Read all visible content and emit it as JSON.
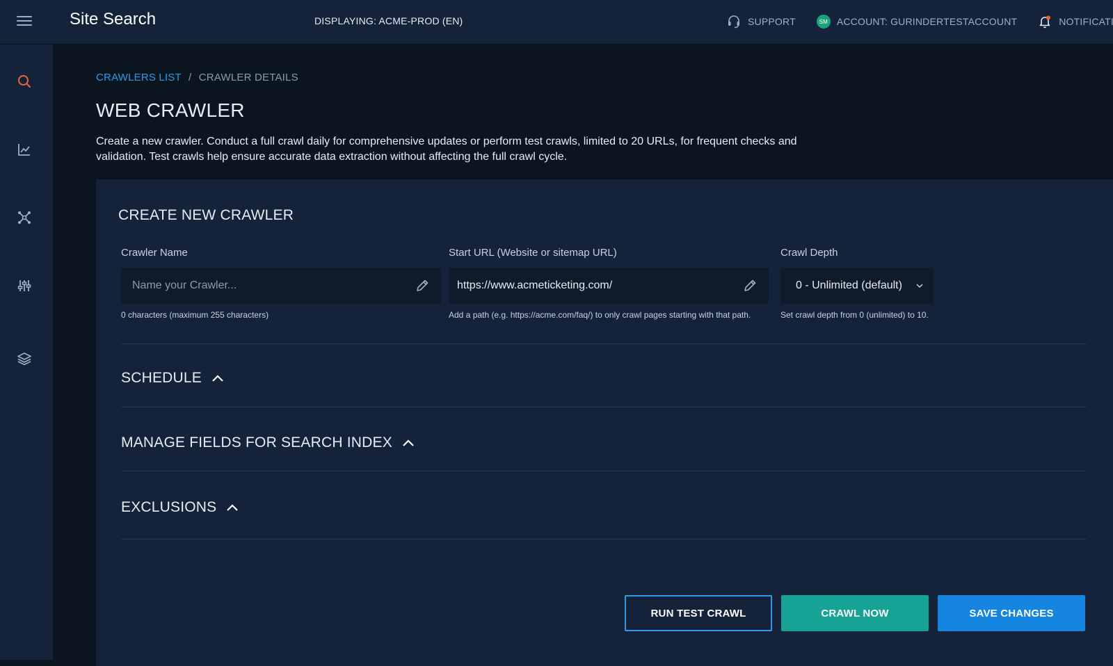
{
  "header": {
    "app_title": "Site Search",
    "displaying": "DISPLAYING: ACME-PROD (EN)",
    "support_label": "SUPPORT",
    "account_initials": "SM",
    "account_label": "ACCOUNT: GURINDERTESTACCOUNT",
    "notifications_label": "NOTIFICATIONS"
  },
  "sidebar": {
    "items": [
      {
        "icon": "search-icon",
        "active": true
      },
      {
        "icon": "chart-icon",
        "active": false
      },
      {
        "icon": "connections-icon",
        "active": false
      },
      {
        "icon": "sliders-icon",
        "active": false
      },
      {
        "icon": "layers-icon",
        "active": false
      }
    ]
  },
  "breadcrumb": {
    "parent": "CRAWLERS LIST",
    "separator": "/",
    "current": "CRAWLER DETAILS"
  },
  "page": {
    "title": "WEB CRAWLER",
    "description": "Create a new crawler. Conduct a full crawl daily for comprehensive updates or perform test crawls, limited to 20 URLs, for frequent checks and validation. Test crawls help ensure accurate data extraction without affecting the full crawl cycle."
  },
  "form": {
    "title": "CREATE NEW CRAWLER",
    "crawler_name": {
      "label": "Crawler Name",
      "placeholder": "Name your Crawler...",
      "value": "",
      "help": "0 characters (maximum 255 characters)"
    },
    "start_url": {
      "label": "Start URL (Website or sitemap URL)",
      "value": "https://www.acmeticketing.com/",
      "help": "Add a path (e.g. https://acme.com/faq/) to only crawl pages starting with that path."
    },
    "crawl_depth": {
      "label": "Crawl Depth",
      "selected": "0 - Unlimited (default)",
      "help": "Set crawl depth from 0 (unlimited) to 10."
    }
  },
  "sections": {
    "schedule": "SCHEDULE",
    "manage_fields": "MANAGE FIELDS FOR SEARCH INDEX",
    "exclusions": "EXCLUSIONS"
  },
  "actions": {
    "run_test_crawl": "RUN TEST CRAWL",
    "crawl_now": "CRAWL NOW",
    "save_changes": "SAVE CHANGES"
  },
  "colors": {
    "accent_orange": "#e8663a",
    "link_blue": "#2f9ae8",
    "teal": "#16a295",
    "primary_blue": "#1685e0",
    "panel_bg": "#14233a",
    "page_bg": "#0b1520"
  }
}
